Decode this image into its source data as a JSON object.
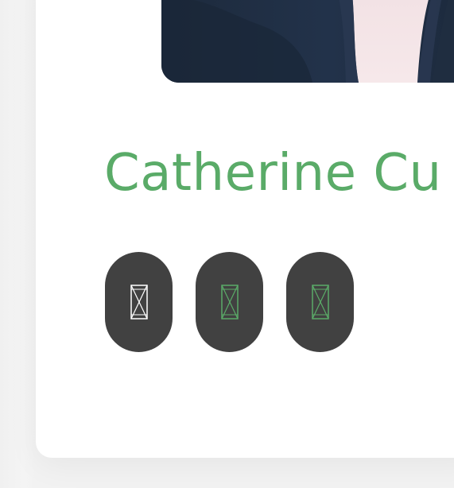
{
  "profile": {
    "name": "Catherine Cu"
  },
  "photo": {
    "alt": ""
  },
  "socials": [
    {
      "icon": "missing-glyph-icon",
      "color": "#ffffff"
    },
    {
      "icon": "missing-glyph-icon",
      "color": "#5aab68"
    },
    {
      "icon": "missing-glyph-icon",
      "color": "#5aab68"
    }
  ],
  "colors": {
    "accent": "#5aab68",
    "button_bg": "#414141",
    "card_bg": "#ffffff",
    "page_bg": "#f2f2f2"
  }
}
